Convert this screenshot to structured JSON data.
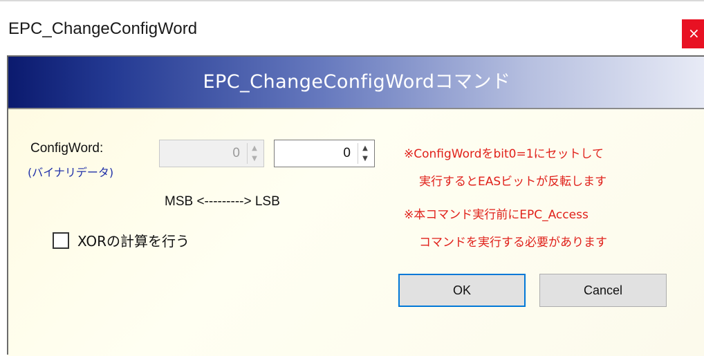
{
  "window": {
    "title": "EPC_ChangeConfigWord",
    "close_glyph": "×"
  },
  "header": {
    "title": "EPC_ChangeConfigWordコマンド"
  },
  "form": {
    "configword_label": "ConfigWord:",
    "binary_label": "(バイナリデータ)",
    "msb_value": "0",
    "lsb_value": "0",
    "msb_lsb_label": "MSB <---------> LSB",
    "xor_label": "XORの計算を行う",
    "xor_checked": false
  },
  "notes": {
    "note1_line1": "※ConfigWordをbit0=1にセットして",
    "note1_line2": "実行するとEASビットが反転します",
    "note2_line1": "※本コマンド実行前にEPC_Access",
    "note2_line2": "コマンドを実行する必要があります"
  },
  "buttons": {
    "ok": "OK",
    "cancel": "Cancel"
  },
  "icons": {
    "spin_up": "▲",
    "spin_down": "▼"
  },
  "colors": {
    "note_red": "#e0201a",
    "binary_blue": "#1f2fa8",
    "close_red": "#e81123",
    "default_button_border": "#0078d7"
  }
}
